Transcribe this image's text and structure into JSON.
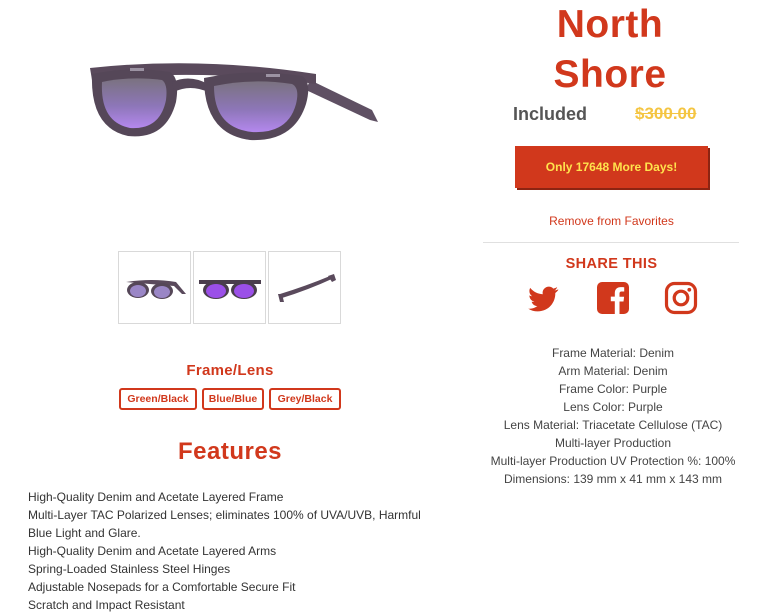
{
  "product": {
    "title_line1": "North",
    "title_line2": "Shore",
    "price_included": "Included",
    "price_original": "$300.00",
    "cta_label": "Only 17648 More Days!",
    "favorites_label": "Remove from Favorites"
  },
  "gallery": {
    "main_image": "sunglasses-main-image",
    "thumbnails": [
      "sunglasses-angle-thumb",
      "sunglasses-front-thumb",
      "sunglasses-side-thumb"
    ]
  },
  "options": {
    "title": "Frame/Lens",
    "choices": [
      "Green/Black",
      "Blue/Blue",
      "Grey/Black"
    ]
  },
  "features": {
    "title": "Features",
    "items": [
      "High-Quality Denim and Acetate Layered Frame",
      "Multi-Layer TAC Polarized Lenses; eliminates 100% of UVA/UVB, Harmful Blue Light and Glare.",
      "High-Quality Denim and Acetate Layered Arms",
      "Spring-Loaded Stainless Steel Hinges",
      "Adjustable Nosepads for a Comfortable Secure Fit",
      "Scratch and Impact Resistant"
    ]
  },
  "share": {
    "title": "SHARE THIS",
    "icons": [
      "twitter-icon",
      "facebook-icon",
      "instagram-icon"
    ]
  },
  "specs": [
    "Frame Material: Denim",
    "Arm Material: Denim",
    "Frame Color: Purple",
    "Lens Color: Purple",
    "Lens Material: Triacetate Cellulose (TAC)",
    "Multi-layer Production",
    "Multi-layer Production UV Protection %: 100%",
    "Dimensions: 139 mm x 41 mm x 143 mm"
  ],
  "colors": {
    "accent": "#d1381c",
    "cta_text": "#ffe34d",
    "strike_price": "#f4c542",
    "frame": "#5a4a5c",
    "lens": "#9b6fd6"
  }
}
